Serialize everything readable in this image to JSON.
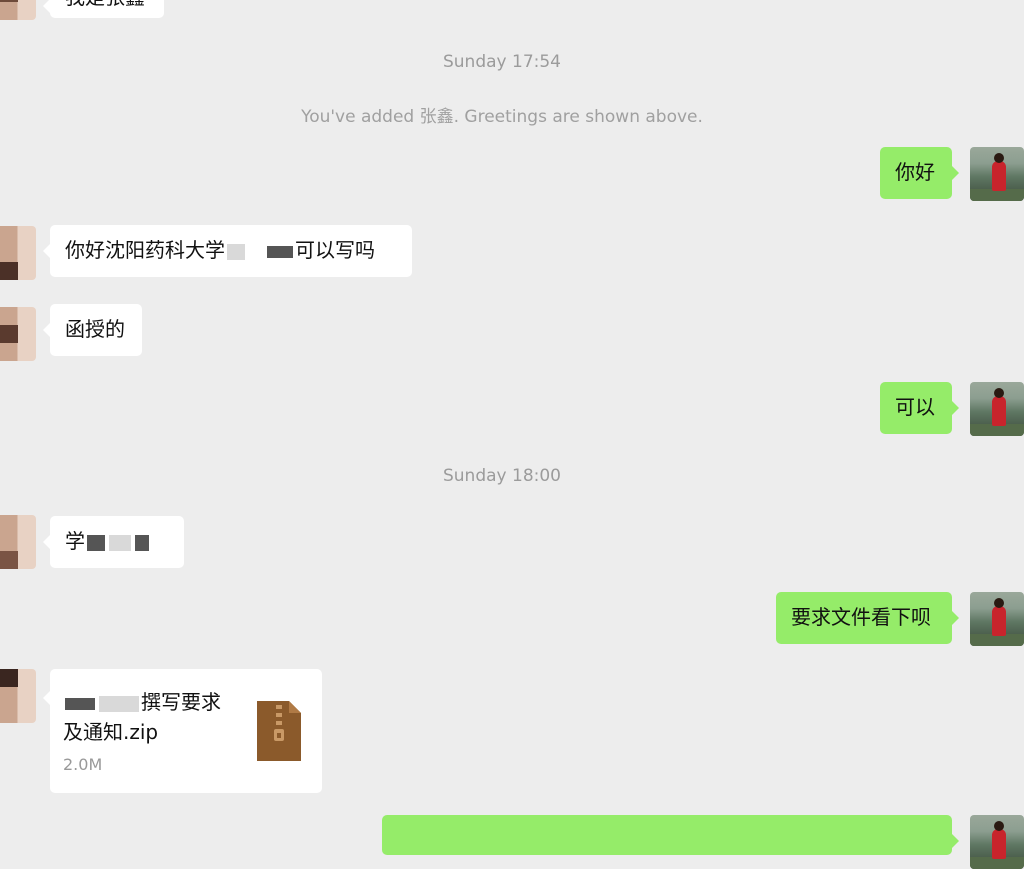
{
  "chat": {
    "top_partial_text": "我是张鑫",
    "timestamps": [
      "Sunday 17:54",
      "Sunday 18:00"
    ],
    "system_notice": "You've added 张鑫. Greetings are shown above.",
    "messages": [
      {
        "side": "out",
        "text": "你好"
      },
      {
        "side": "in",
        "text_before": "你好沈阳药科大学",
        "text_after": "可以写吗"
      },
      {
        "side": "in",
        "text": "函授的"
      },
      {
        "side": "out",
        "text": "可以"
      },
      {
        "side": "in",
        "text": "学"
      },
      {
        "side": "out",
        "text": "要求文件看下呗"
      }
    ],
    "file": {
      "name_line1": "撰写要求",
      "name_line2": "及通知.zip",
      "size": "2.0M",
      "icon": "zip-archive-icon"
    }
  },
  "colors": {
    "background": "#ededed",
    "incoming_bubble": "#ffffff",
    "outgoing_bubble": "#95ec69",
    "zip_icon": "#8b5a2b"
  }
}
